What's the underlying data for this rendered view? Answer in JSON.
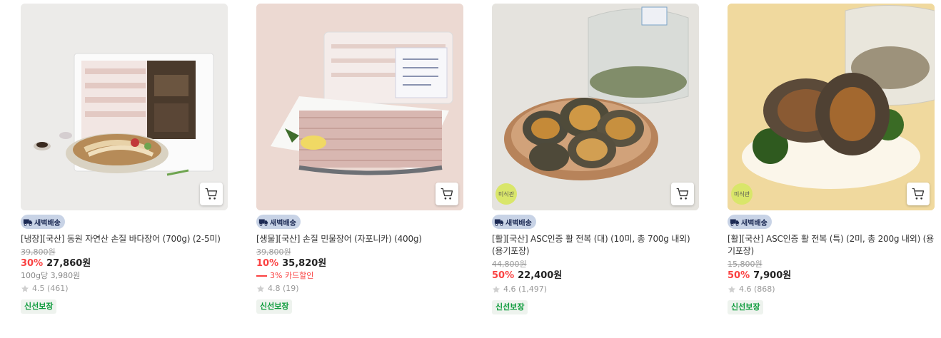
{
  "products": [
    {
      "title": "[냉장][국산] 동원 자연산 손질 바다장어 (700g) (2-5미)",
      "original_price": "39,800원",
      "discount": "30%",
      "price": "27,860원",
      "unit_price": "100g당 3,980원",
      "card_discount": "",
      "rating": "4.5",
      "reviews": "(461)",
      "delivery_badge": "새벽배송",
      "fresh_badge": "신선보장",
      "mi_badge": ""
    },
    {
      "title": "[생물][국산] 손질 민물장어 (자포니카) (400g)",
      "original_price": "39,800원",
      "discount": "10%",
      "price": "35,820원",
      "unit_price": "",
      "card_discount": "3% 카드할인",
      "rating": "4.8",
      "reviews": "(19)",
      "delivery_badge": "새벽배송",
      "fresh_badge": "신선보장",
      "mi_badge": ""
    },
    {
      "title": "[활][국산] ASC인증 활 전복 (대) (10미, 총 700g 내외) (용기포장)",
      "original_price": "44,800원",
      "discount": "50%",
      "price": "22,400원",
      "unit_price": "",
      "card_discount": "",
      "rating": "4.6",
      "reviews": "(1,497)",
      "delivery_badge": "새벽배송",
      "fresh_badge": "신선보장",
      "mi_badge": "미식관"
    },
    {
      "title": "[활][국산] ASC인증 활 전복 (특) (2미, 총 200g 내외) (용기포장)",
      "original_price": "15,800원",
      "discount": "50%",
      "price": "7,900원",
      "unit_price": "",
      "card_discount": "",
      "rating": "4.6",
      "reviews": "(868)",
      "delivery_badge": "새벽배송",
      "fresh_badge": "신선보장",
      "mi_badge": "미식관"
    }
  ],
  "icons": {
    "cart": "cart-icon",
    "delivery": "truck-icon",
    "star": "star-icon"
  },
  "colors": {
    "discount": "#fa4141",
    "fresh": "#0d9b3b",
    "delivery_badge_bg": "#c8d3e6",
    "mi_badge_bg": "#d9e66a"
  }
}
